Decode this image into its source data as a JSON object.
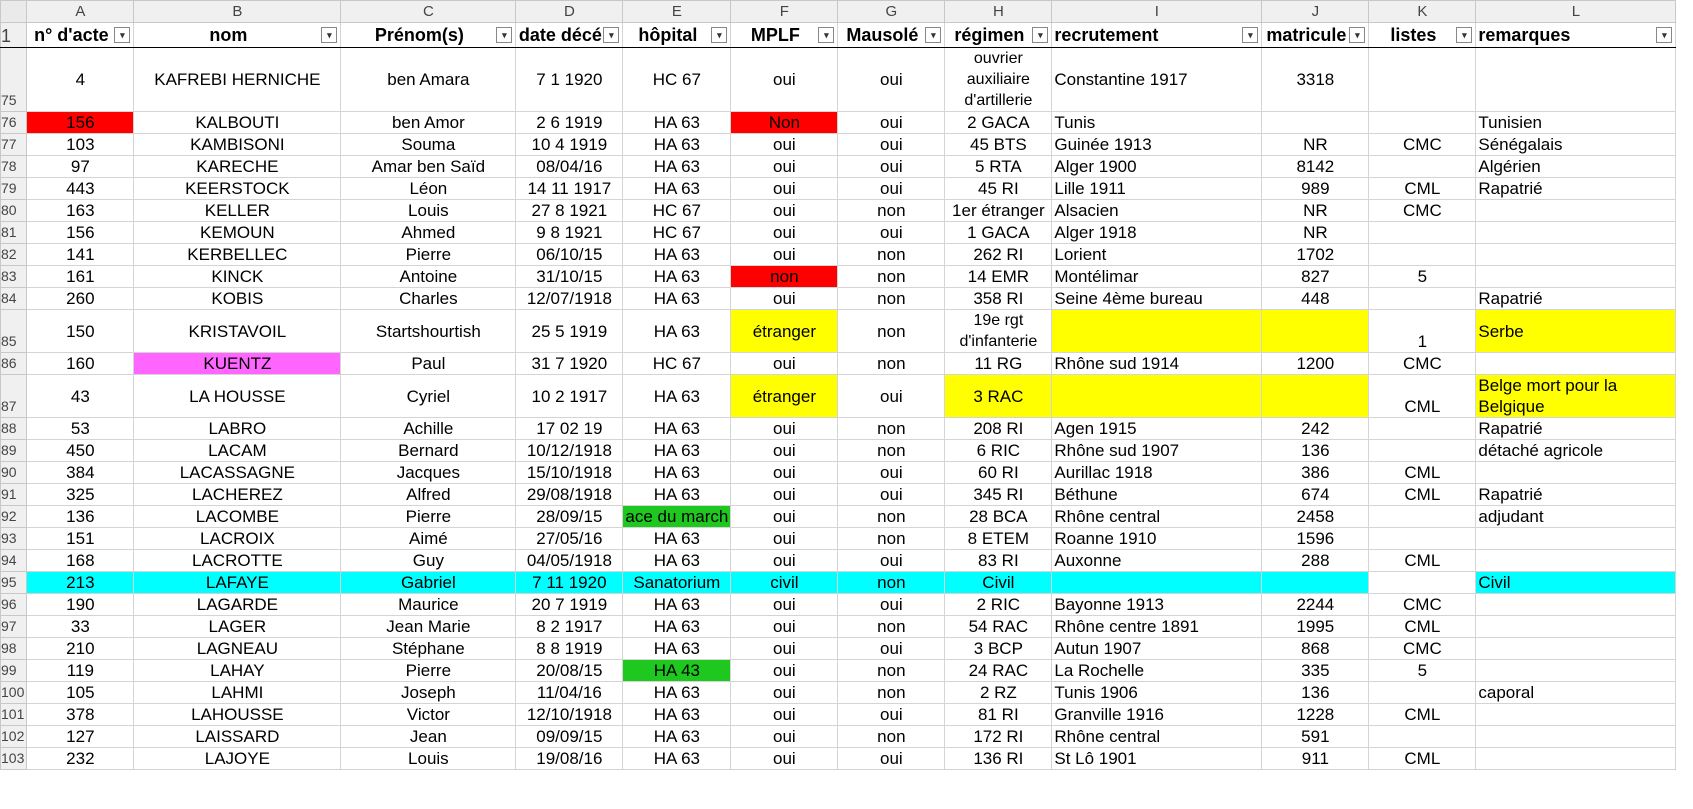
{
  "columns": [
    "A",
    "B",
    "C",
    "D",
    "E",
    "F",
    "G",
    "H",
    "I",
    "J",
    "K",
    "L"
  ],
  "header": {
    "row_number": "1",
    "cells": [
      "n° d'acte",
      "nom",
      "Prénom(s)",
      "date décé",
      "hôpital",
      "MPLF",
      "Mausolé",
      "régimen",
      "recrutement",
      "matricule",
      "listes",
      "remarques"
    ]
  },
  "rows": [
    {
      "n": "75",
      "c": [
        "4",
        "KAFREBI HERNICHE",
        "ben Amara",
        "7 1 1920",
        "HC 67",
        "oui",
        "oui",
        "ouvrier auxiliaire d'artillerie",
        "Constantine 1917",
        "3318",
        "",
        ""
      ]
    },
    {
      "n": "76",
      "c": [
        "156",
        "KALBOUTI",
        "ben Amor",
        "2 6 1919",
        "HA 63",
        "Non",
        "oui",
        "2 GACA",
        "Tunis",
        "",
        "",
        "Tunisien"
      ]
    },
    {
      "n": "77",
      "c": [
        "103",
        "KAMBISONI",
        "Souma",
        "10 4 1919",
        "HA 63",
        "oui",
        "oui",
        "45 BTS",
        "Guinée 1913",
        "NR",
        "CMC",
        "Sénégalais"
      ]
    },
    {
      "n": "78",
      "c": [
        "97",
        "KARECHE",
        "Amar ben Saïd",
        "08/04/16",
        "HA 63",
        "oui",
        "oui",
        "5 RTA",
        "Alger 1900",
        "8142",
        "",
        "Algérien"
      ]
    },
    {
      "n": "79",
      "c": [
        "443",
        "KEERSTOCK",
        "Léon",
        "14 11 1917",
        "HA 63",
        "oui",
        "oui",
        "45 RI",
        "Lille  1911",
        "989",
        "CML",
        "Rapatrié"
      ]
    },
    {
      "n": "80",
      "c": [
        "163",
        "KELLER",
        "Louis",
        "27 8 1921",
        "HC 67",
        "oui",
        "non",
        "1er étranger",
        "Alsacien",
        "NR",
        "CMC",
        ""
      ]
    },
    {
      "n": "81",
      "c": [
        "156",
        "KEMOUN",
        "Ahmed",
        "9 8 1921",
        "HC 67",
        "oui",
        "oui",
        "1 GACA",
        "Alger 1918",
        "NR",
        "",
        ""
      ]
    },
    {
      "n": "82",
      "c": [
        "141",
        "KERBELLEC",
        "Pierre",
        "06/10/15",
        "HA 63",
        "oui",
        "non",
        "262 RI",
        "Lorient",
        "1702",
        "",
        ""
      ]
    },
    {
      "n": "83",
      "c": [
        "161",
        "KINCK",
        "Antoine",
        "31/10/15",
        "HA 63",
        "non",
        "non",
        "14 EMR",
        "Montélimar",
        "827",
        "5",
        ""
      ]
    },
    {
      "n": "84",
      "c": [
        "260",
        "KOBIS",
        "Charles",
        "12/07/1918",
        "HA 63",
        "oui",
        "non",
        "358 RI",
        "Seine 4ème bureau",
        "448",
        "",
        "Rapatrié"
      ]
    },
    {
      "n": "85",
      "c": [
        "150",
        "KRISTAVOIL",
        "Startshourtish",
        "25 5 1919",
        "HA 63",
        "étranger",
        "non",
        "19e rgt d'infanterie",
        "",
        "",
        "1",
        "Serbe"
      ]
    },
    {
      "n": "86",
      "c": [
        "160",
        "KUENTZ",
        "Paul",
        "31 7 1920",
        "HC 67",
        "oui",
        "non",
        "11 RG",
        "Rhône sud  1914",
        "1200",
        "CMC",
        ""
      ]
    },
    {
      "n": "87",
      "c": [
        "43",
        "LA HOUSSE",
        "Cyriel",
        "10 2 1917",
        "HA 63",
        "étranger",
        "oui",
        "3 RAC",
        "",
        "",
        "CML",
        "Belge mort pour la Belgique"
      ]
    },
    {
      "n": "88",
      "c": [
        "53",
        "LABRO",
        "Achille",
        "17 02 19",
        "HA 63",
        "oui",
        "non",
        "208 RI",
        "Agen 1915",
        "242",
        "",
        "Rapatrié"
      ]
    },
    {
      "n": "89",
      "c": [
        "450",
        "LACAM",
        "Bernard",
        "10/12/1918",
        "HA 63",
        "oui",
        "non",
        "6 RIC",
        "Rhône sud 1907",
        "136",
        "",
        "détaché agricole"
      ]
    },
    {
      "n": "90",
      "c": [
        "384",
        "LACASSAGNE",
        "Jacques",
        "15/10/1918",
        "HA 63",
        "oui",
        "oui",
        "60 RI",
        "Aurillac  1918",
        "386",
        "CML",
        ""
      ]
    },
    {
      "n": "91",
      "c": [
        "325",
        "LACHEREZ",
        "Alfred",
        "29/08/1918",
        "HA 63",
        "oui",
        "oui",
        "345 RI",
        "Béthune",
        "674",
        "CML",
        "Rapatrié"
      ]
    },
    {
      "n": "92",
      "c": [
        "136",
        "LACOMBE",
        "Pierre",
        "28/09/15",
        "ace du march",
        "oui",
        "non",
        "28 BCA",
        "Rhône central",
        "2458",
        "",
        "adjudant"
      ]
    },
    {
      "n": "93",
      "c": [
        "151",
        "LACROIX",
        "Aimé",
        "27/05/16",
        "HA 63",
        "oui",
        "non",
        "8 ETEM",
        "Roanne 1910",
        "1596",
        "",
        ""
      ]
    },
    {
      "n": "94",
      "c": [
        "168",
        "LACROTTE",
        "Guy",
        "04/05/1918",
        "HA 63",
        "oui",
        "oui",
        "83 RI",
        "Auxonne",
        "288",
        "CML",
        ""
      ]
    },
    {
      "n": "95",
      "c": [
        "213",
        "LAFAYE",
        "Gabriel",
        "7 11 1920",
        "Sanatorium",
        "civil",
        "non",
        "Civil",
        "",
        "",
        "",
        "Civil"
      ]
    },
    {
      "n": "96",
      "c": [
        "190",
        "LAGARDE",
        "Maurice",
        "20 7 1919",
        "HA 63",
        "oui",
        "oui",
        "2 RIC",
        "Bayonne  1913",
        "2244",
        "CMC",
        ""
      ]
    },
    {
      "n": "97",
      "c": [
        "33",
        "LAGER",
        "Jean Marie",
        "8 2 1917",
        "HA 63",
        "oui",
        "non",
        "54 RAC",
        "Rhône centre 1891",
        "1995",
        "CML",
        ""
      ]
    },
    {
      "n": "98",
      "c": [
        "210",
        "LAGNEAU",
        "Stéphane",
        "8 8 1919",
        "HA 63",
        "oui",
        "oui",
        "3 BCP",
        "Autun 1907",
        "868",
        "CMC",
        ""
      ]
    },
    {
      "n": "99",
      "c": [
        "119",
        "LAHAY",
        "Pierre",
        "20/08/15",
        "HA 43",
        "oui",
        "non",
        "24 RAC",
        "La Rochelle",
        "335",
        "5",
        ""
      ]
    },
    {
      "n": "100",
      "c": [
        "105",
        "LAHMI",
        "Joseph",
        "11/04/16",
        "HA 63",
        "oui",
        "non",
        "2 RZ",
        "Tunis 1906",
        "136",
        "",
        "caporal"
      ]
    },
    {
      "n": "101",
      "c": [
        "378",
        "LAHOUSSE",
        "Victor",
        "12/10/1918",
        "HA 63",
        "oui",
        "oui",
        "81 RI",
        "Granville  1916",
        "1228",
        "CML",
        ""
      ]
    },
    {
      "n": "102",
      "c": [
        "127",
        "LAISSARD",
        "Jean",
        "09/09/15",
        "HA 63",
        "oui",
        "non",
        "172 RI",
        "Rhône central",
        "591",
        "",
        ""
      ]
    },
    {
      "n": "103",
      "c": [
        "232",
        "LAJOYE",
        "Louis",
        "19/08/16",
        "HA 63",
        "oui",
        "oui",
        "136 RI",
        "St Lô  1901",
        "911",
        "CML",
        ""
      ]
    }
  ],
  "colors": {
    "red": "#ff0000",
    "light_red": "#f24a4a",
    "yellow": "#ffff00",
    "magenta": "#ff66ff",
    "green": "#1ec81e",
    "cyan": "#00ffff",
    "excel_green": "#1e7145"
  },
  "icons": {
    "filter": "filter-dropdown-icon"
  }
}
